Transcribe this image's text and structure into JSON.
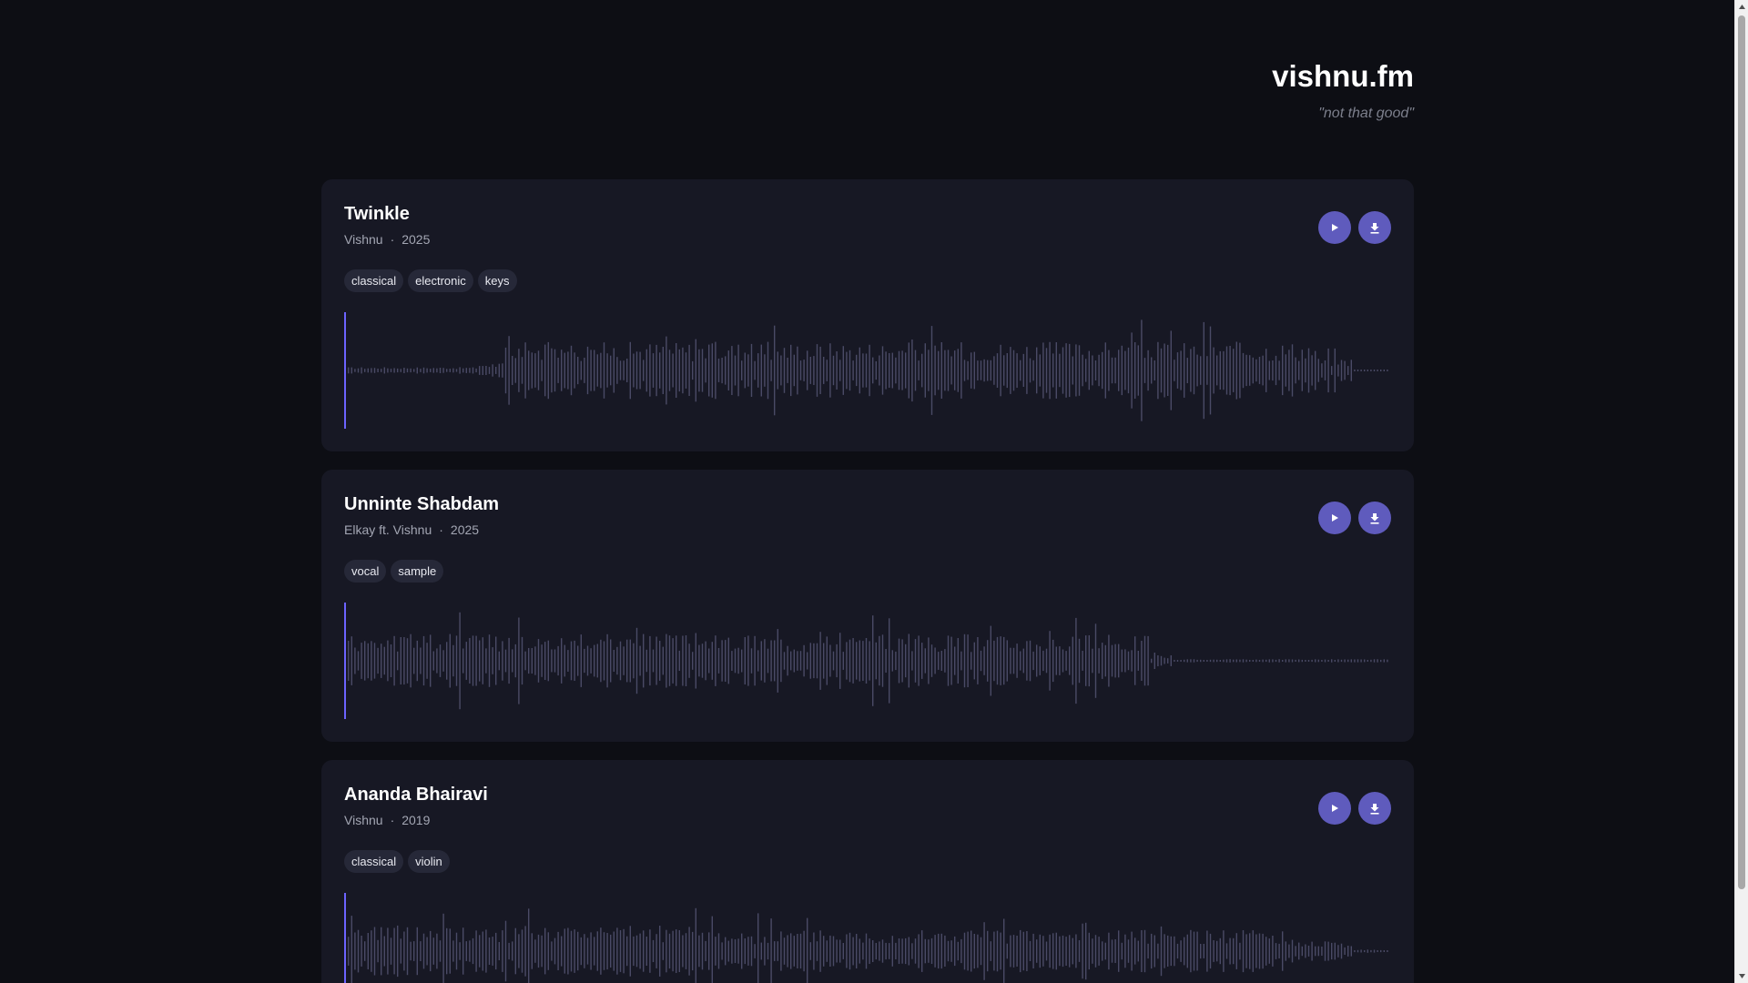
{
  "site": {
    "title": "vishnu.fm",
    "tagline": "\"not that good\""
  },
  "colors": {
    "background": "#0d0e14",
    "card": "#171824",
    "accent": "#5f5bbd",
    "waveform_bar": "#4a4a66",
    "playhead": "#6c63ff"
  },
  "tracks": [
    {
      "title": "Twinkle",
      "artist": "Vishnu",
      "year": "2025",
      "tags": [
        "classical",
        "electronic",
        "keys"
      ],
      "play_icon": "play-icon",
      "download_icon": "download-icon"
    },
    {
      "title": "Unninte Shabdam",
      "artist": "Elkay ft. Vishnu",
      "year": "2025",
      "tags": [
        "vocal",
        "sample"
      ],
      "play_icon": "play-icon",
      "download_icon": "download-icon"
    },
    {
      "title": "Ananda Bhairavi",
      "artist": "Vishnu",
      "year": "2019",
      "tags": [
        "classical",
        "violin"
      ],
      "play_icon": "play-icon",
      "download_icon": "download-icon"
    }
  ]
}
